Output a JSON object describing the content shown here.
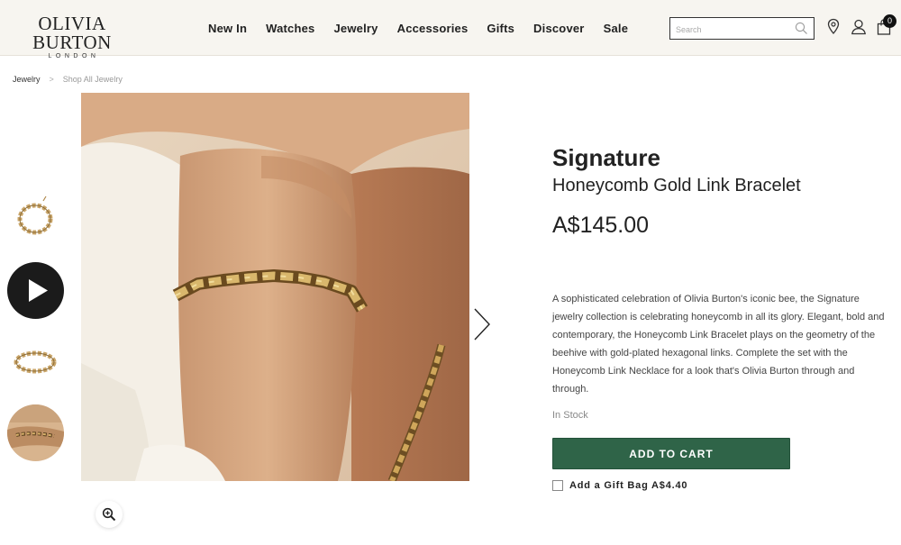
{
  "brand": {
    "name": "OLIVIA BURTON",
    "sub": "LONDON"
  },
  "nav": [
    {
      "label": "New In"
    },
    {
      "label": "Watches"
    },
    {
      "label": "Jewelry"
    },
    {
      "label": "Accessories"
    },
    {
      "label": "Gifts"
    },
    {
      "label": "Discover"
    },
    {
      "label": "Sale"
    }
  ],
  "search": {
    "placeholder": "Search",
    "value": ""
  },
  "header_icons": [
    "location-pin-icon",
    "user-icon",
    "shopping-bag-icon"
  ],
  "cart": {
    "count": "0"
  },
  "breadcrumb": {
    "parent": "Jewelry",
    "separator": ">",
    "current": "Shop All Jewelry"
  },
  "product": {
    "collection": "Signature",
    "name": "Honeycomb Gold Link Bracelet",
    "price": "A$145.00",
    "description": "A sophisticated celebration of Olivia Burton's iconic bee, the Signature jewelry collection is celebrating honeycomb in all its glory. Elegant, bold and contemporary, the Honeycomb Link Bracelet plays on the geometry of the beehive with gold-plated hexagonal links. Complete the set with the Honeycomb Link Necklace for a look that's Olivia Burton through and through.",
    "stock": "In Stock",
    "add_to_cart": "ADD TO CART",
    "gift_bag": "Add a Gift Bag A$4.40",
    "gift_bag_checked": false
  },
  "colors": {
    "accent": "#2f6448",
    "header_bg": "#f7f5f0",
    "text": "#222222"
  }
}
